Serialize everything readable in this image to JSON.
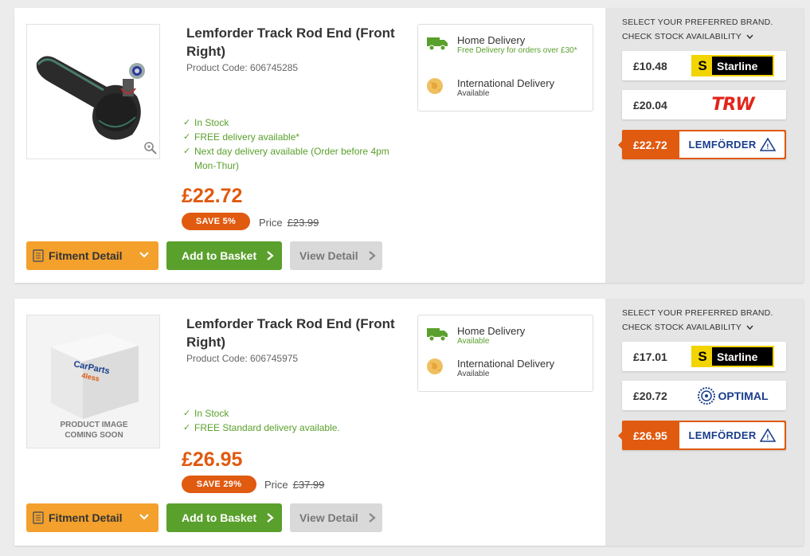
{
  "products": [
    {
      "title": "Lemforder Track Rod End (Front Right)",
      "product_code": "Product Code: 606745285",
      "stock_lines": [
        "In Stock",
        "FREE delivery available*",
        "Next day delivery available (Order before 4pm Mon-Thur)"
      ],
      "price": "£22.72",
      "save_label": "SAVE  5%",
      "rrp_label": "Price",
      "rrp_value": "£23.99",
      "buttons": {
        "fitment": "Fitment Detail",
        "basket": "Add to Basket",
        "view": "View Detail"
      },
      "delivery": {
        "home_title": "Home Delivery",
        "home_sub": "Free Delivery for orders over £30*",
        "intl_title": "International Delivery",
        "intl_sub": "Available"
      },
      "brand_panel": {
        "heading": "SELECT YOUR PREFERRED BRAND.",
        "subheading": "CHECK STOCK AVAILABILITY",
        "options": [
          {
            "price": "£10.48",
            "brand": "Starline",
            "selected": false
          },
          {
            "price": "£20.04",
            "brand": "TRW",
            "selected": false
          },
          {
            "price": "£22.72",
            "brand": "LEMFÖRDER",
            "selected": true
          }
        ]
      }
    },
    {
      "title": "Lemforder Track Rod End (Front Right)",
      "product_code": "Product Code: 606745975",
      "image_placeholder": {
        "brand": "CarParts",
        "brand_sub": "4less",
        "line1": "PRODUCT IMAGE",
        "line2": "COMING SOON"
      },
      "stock_lines": [
        "In Stock",
        "FREE Standard delivery available."
      ],
      "price": "£26.95",
      "save_label": "SAVE  29%",
      "rrp_label": "Price",
      "rrp_value": "£37.99",
      "buttons": {
        "fitment": "Fitment Detail",
        "basket": "Add to Basket",
        "view": "View Detail"
      },
      "delivery": {
        "home_title": "Home Delivery",
        "home_sub": "Available",
        "intl_title": "International Delivery",
        "intl_sub": "Available"
      },
      "brand_panel": {
        "heading": "SELECT YOUR PREFERRED BRAND.",
        "subheading": "CHECK STOCK AVAILABILITY",
        "options": [
          {
            "price": "£17.01",
            "brand": "Starline",
            "selected": false
          },
          {
            "price": "£20.72",
            "brand": "OPTIMAL",
            "selected": false
          },
          {
            "price": "£26.95",
            "brand": "LEMFÖRDER",
            "selected": true
          }
        ]
      }
    }
  ],
  "colors": {
    "accent_orange": "#e05a10",
    "fitment_orange": "#f3a02c",
    "green": "#5aa02c",
    "panel_grey": "#e5e5e5"
  }
}
